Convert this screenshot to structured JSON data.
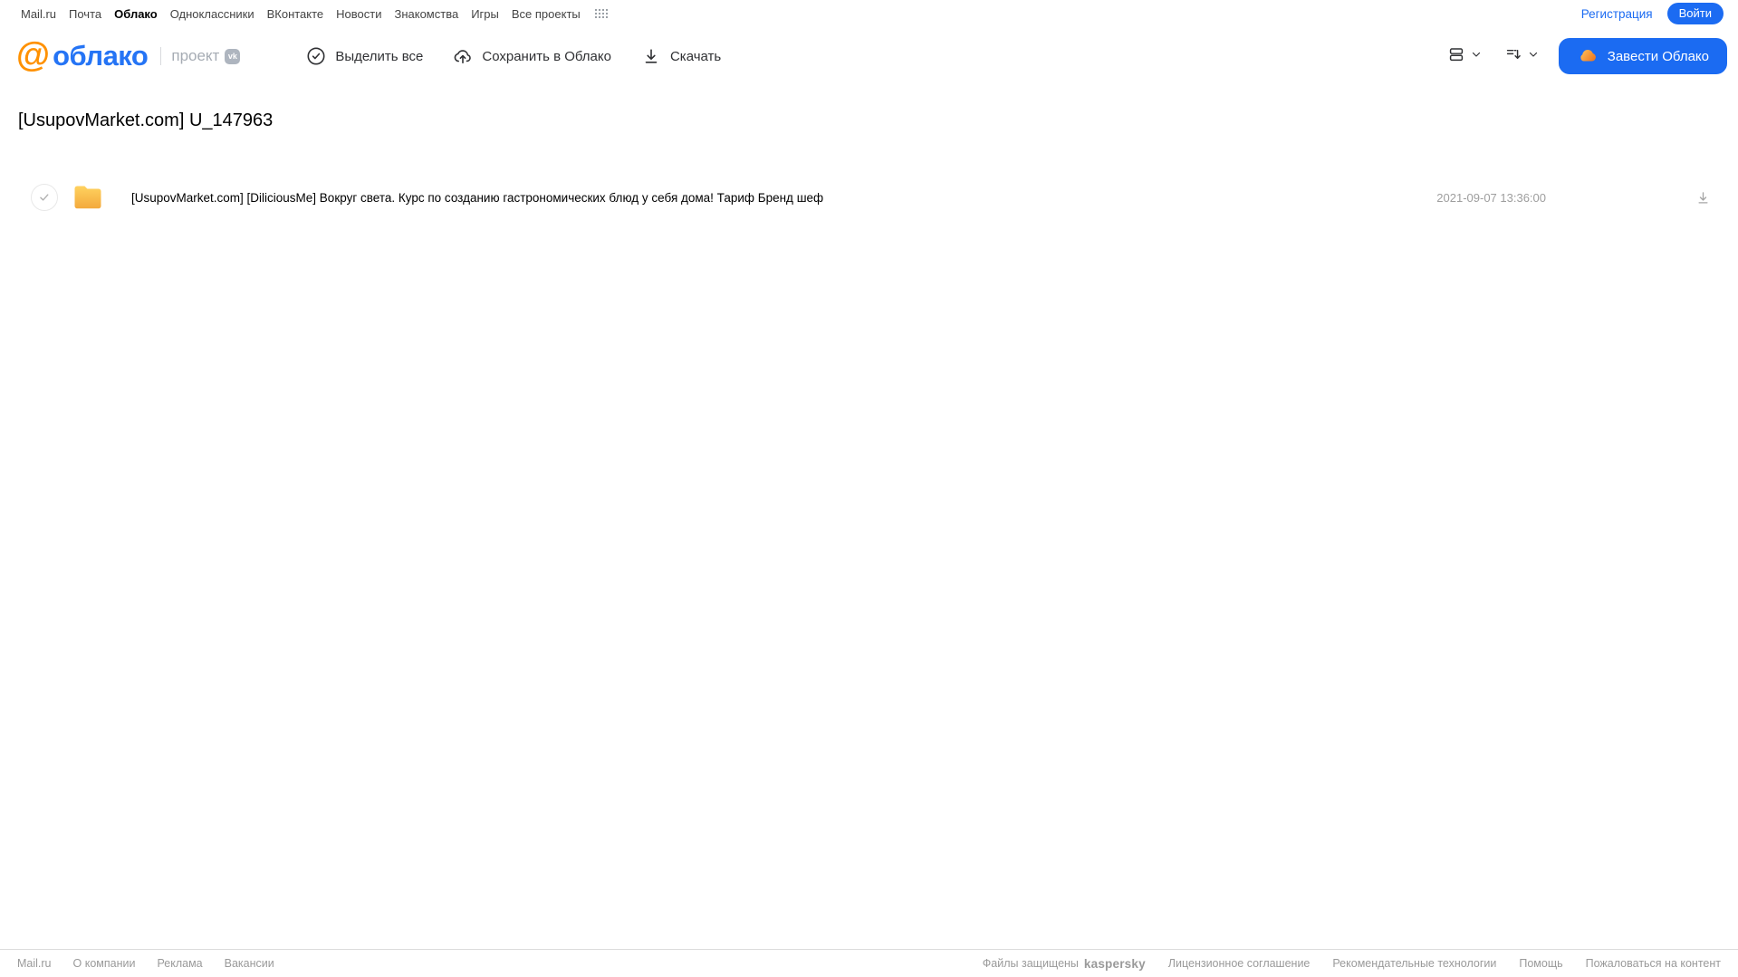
{
  "top_nav": {
    "items": [
      "Mail.ru",
      "Почта",
      "Облако",
      "Одноклассники",
      "ВКонтакте",
      "Новости",
      "Знакомства",
      "Игры",
      "Все проекты"
    ],
    "active_item": "Облако",
    "registration_label": "Регистрация",
    "login_label": "Войти"
  },
  "header": {
    "logo_at": "@",
    "logo_text": "облако",
    "logo_suffix": "проект",
    "vk_badge": "vk",
    "toolbar": {
      "select_all_label": "Выделить все",
      "save_to_cloud_label": "Сохранить в Облако",
      "download_label": "Скачать",
      "get_cloud_label": "Завести Облако"
    }
  },
  "main": {
    "title": "[UsupovMarket.com] U_147963",
    "files": [
      {
        "type": "folder",
        "name": "[UsupovMarket.com] [DiliciousMe] Вокруг света. Курс по созданию гастрономических блюд у себя дома! Тариф Бренд шеф",
        "date": "2021-09-07 13:36:00"
      }
    ]
  },
  "footer": {
    "left_links": [
      "Mail.ru",
      "О компании",
      "Реклама",
      "Вакансии"
    ],
    "protected_label": "Файлы защищены",
    "kaspersky_label": "kaspersky",
    "right_links": [
      "Лицензионное соглашение",
      "Рекомендательные технологии",
      "Помощь",
      "Пожаловаться на контент"
    ]
  },
  "icons": {
    "apps-grid-icon": "grid of dots",
    "check-circle-icon": "circled check",
    "cloud-upload-icon": "cloud with up arrow",
    "download-icon": "arrow down to line",
    "view-mode-icon": "stacked rows",
    "sort-icon": "lines with down arrow",
    "chevron-down-icon": "v",
    "cloud-icon": "orange cloud",
    "folder-icon": "yellow folder",
    "vk-icon": "vk badge"
  },
  "colors": {
    "accent_blue": "#1b6bf2",
    "logo_blue": "#2574f5",
    "logo_orange": "#ff9100",
    "folder_yellow_top": "#ffd25f",
    "folder_yellow_bottom": "#f3a93c",
    "kaspersky_teal": "#00a88e",
    "muted_gray": "#9a9a9a"
  }
}
